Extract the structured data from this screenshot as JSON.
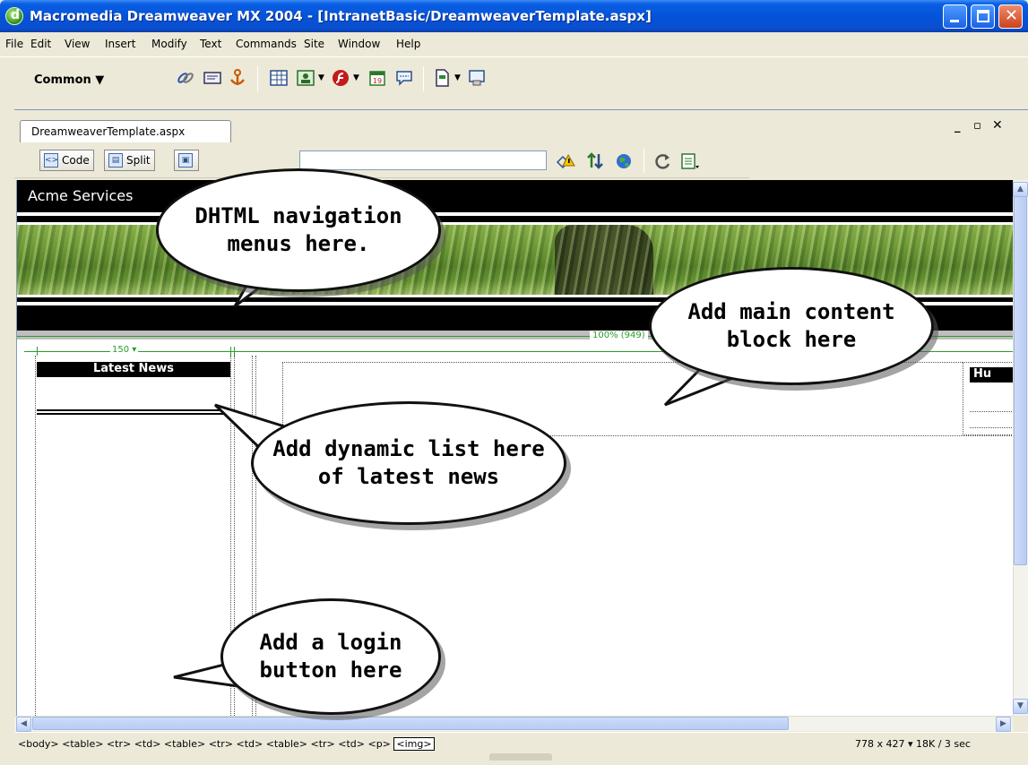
{
  "window": {
    "title": "Macromedia Dreamweaver MX 2004 - [IntranetBasic/DreamweaverTemplate.aspx]"
  },
  "menu": [
    "File",
    "Edit",
    "View",
    "Insert",
    "Modify",
    "Text",
    "Commands",
    "Site",
    "Window",
    "Help"
  ],
  "insert_bar": {
    "category": "Common",
    "icons": [
      "hyperlink-icon",
      "email-link-icon",
      "named-anchor-icon",
      "table-icon",
      "image-icon",
      "media-flash-icon",
      "date-icon",
      "comment-icon",
      "templates-icon",
      "tag-chooser-icon"
    ]
  },
  "document": {
    "tab": "DreamweaverTemplate.aspx",
    "view_buttons": {
      "code": "Code",
      "split": "Split"
    },
    "title_value": ""
  },
  "design": {
    "site_name": "Acme Services",
    "table_width_label": "100% (949)",
    "column_width_label": "150 ▾",
    "news_heading": "Latest News",
    "right_heading": "Hu"
  },
  "callouts": {
    "nav": "DHTML navigation menus here.",
    "main": "Add main content block here",
    "news": "Add dynamic list here of latest news",
    "login": "Add a login button here"
  },
  "statusbar": {
    "tags": "<body> <table> <tr> <td> <table> <tr> <td> <table> <tr> <td> <p>",
    "selected_tag": "<img>",
    "window_size": "778 x 427",
    "download": "18K / 3 sec"
  },
  "colors": {
    "titlebar": "#0553d8",
    "workspace": "#ece9d8",
    "guide_green": "#2a9d2a"
  }
}
